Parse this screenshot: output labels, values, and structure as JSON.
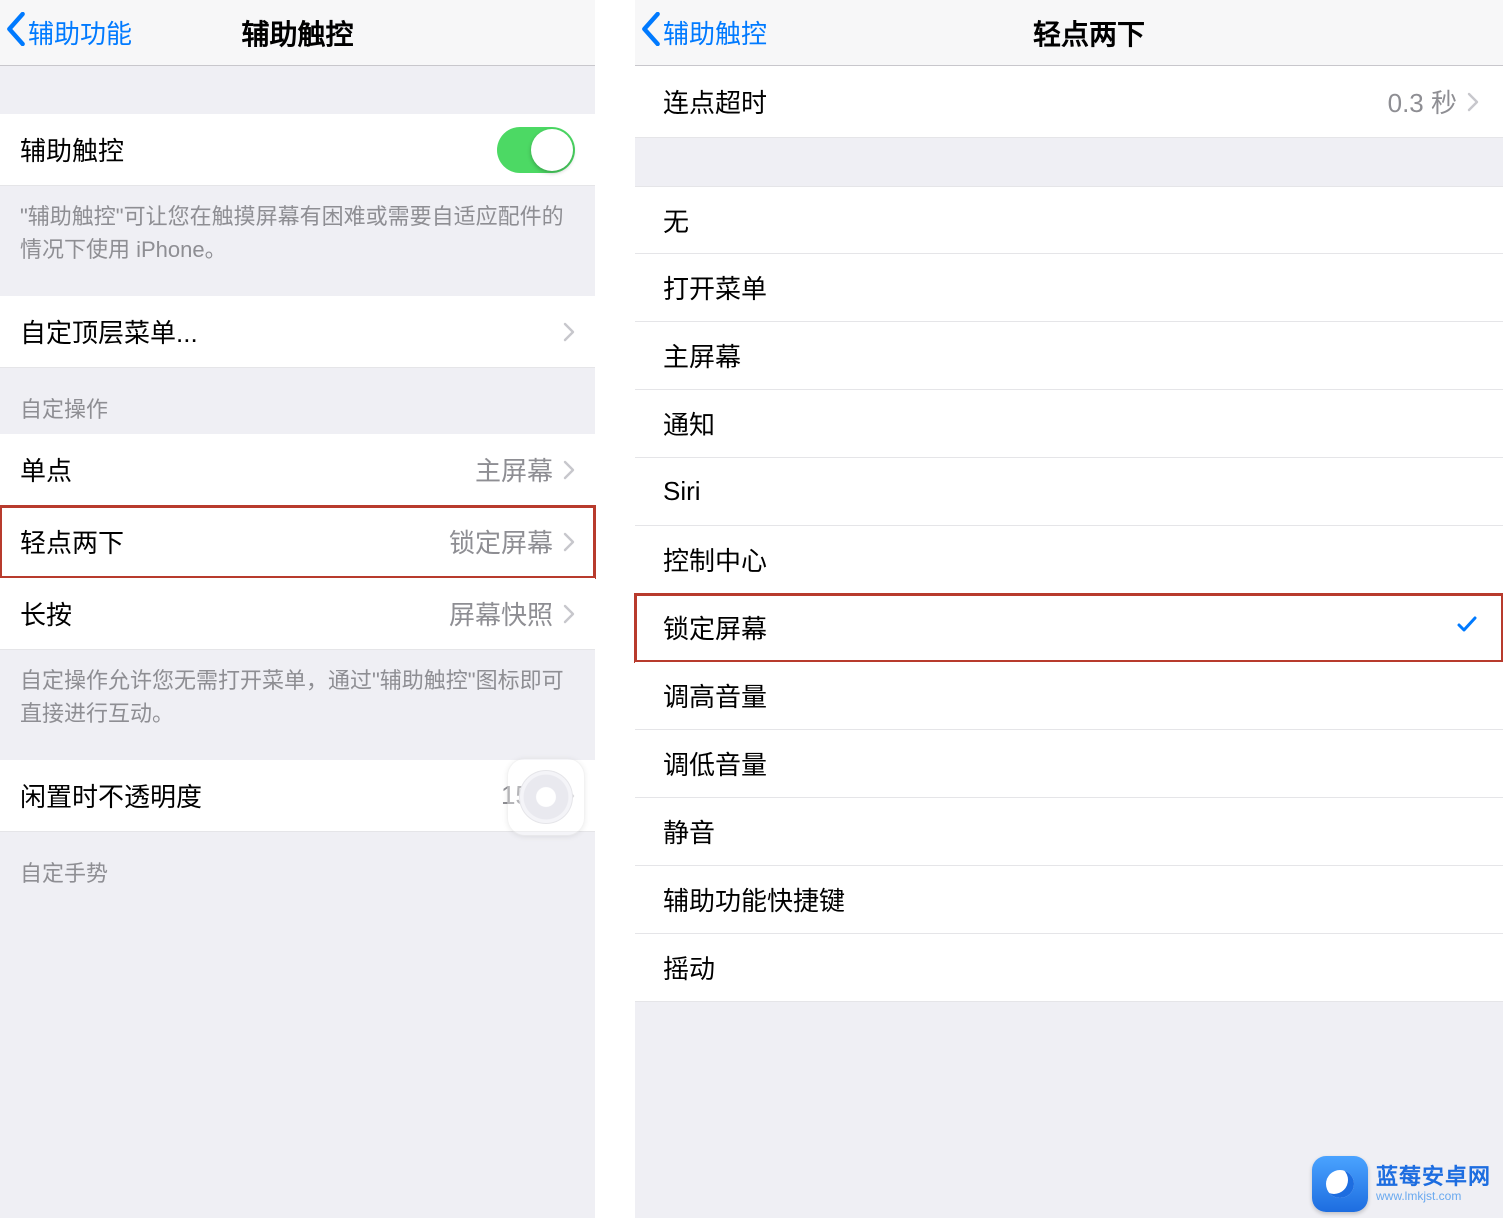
{
  "left": {
    "nav": {
      "back": "辅助功能",
      "title": "辅助触控"
    },
    "toggle_row": {
      "label": "辅助触控",
      "footer": "\"辅助触控\"可让您在触摸屏幕有困难或需要自适应配件的情况下使用 iPhone。"
    },
    "top_menu": {
      "label": "自定顶层菜单..."
    },
    "actions_header": "自定操作",
    "actions": [
      {
        "label": "单点",
        "value": "主屏幕"
      },
      {
        "label": "轻点两下",
        "value": "锁定屏幕"
      },
      {
        "label": "长按",
        "value": "屏幕快照"
      }
    ],
    "actions_footer": "自定操作允许您无需打开菜单，通过\"辅助触控\"图标即可直接进行互动。",
    "opacity": {
      "label": "闲置时不透明度",
      "value": "15%"
    },
    "gestures_header": "自定手势"
  },
  "right": {
    "nav": {
      "back": "辅助触控",
      "title": "轻点两下"
    },
    "timeout": {
      "label": "连点超时",
      "value": "0.3 秒"
    },
    "options": [
      {
        "label": "无"
      },
      {
        "label": "打开菜单"
      },
      {
        "label": "主屏幕"
      },
      {
        "label": "通知"
      },
      {
        "label": "Siri"
      },
      {
        "label": "控制中心"
      },
      {
        "label": "锁定屏幕",
        "selected": true
      },
      {
        "label": "调高音量"
      },
      {
        "label": "调低音量"
      },
      {
        "label": "静音"
      },
      {
        "label": "辅助功能快捷键"
      },
      {
        "label": "摇动"
      }
    ]
  },
  "watermark": {
    "main": "蓝莓安卓网",
    "sub": "www.lmkjst.com"
  }
}
